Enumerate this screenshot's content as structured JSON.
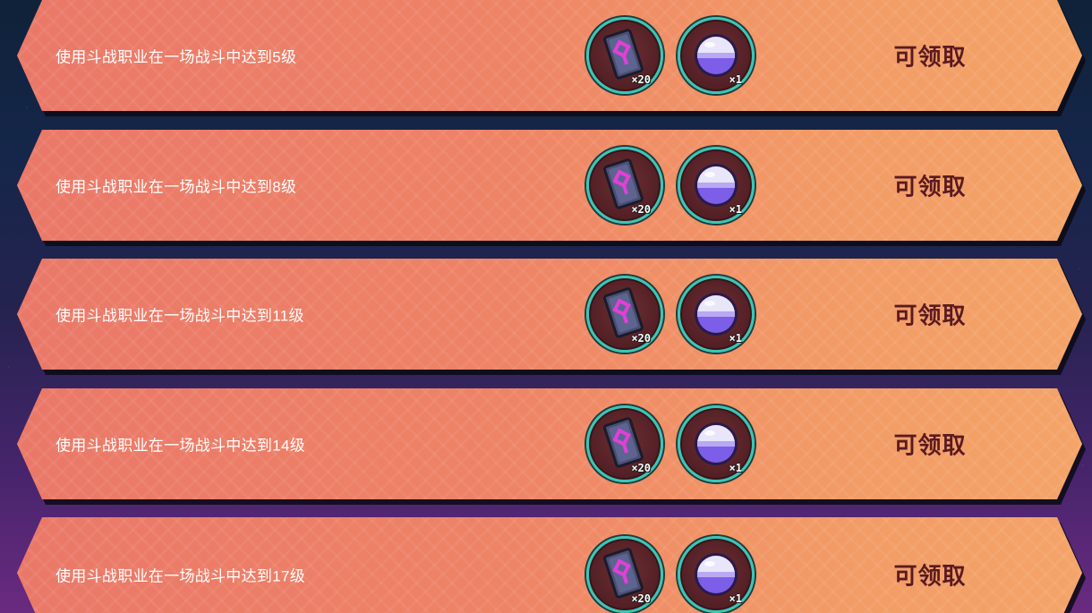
{
  "quests": [
    {
      "title": "使用斗战职业在一场战斗中达到5级",
      "rewards": [
        {
          "icon": "skill-card-icon",
          "qty": "×20"
        },
        {
          "icon": "energy-orb-icon",
          "qty": "×1"
        }
      ],
      "claim_label": "可领取"
    },
    {
      "title": "使用斗战职业在一场战斗中达到8级",
      "rewards": [
        {
          "icon": "skill-card-icon",
          "qty": "×20"
        },
        {
          "icon": "energy-orb-icon",
          "qty": "×1"
        }
      ],
      "claim_label": "可领取"
    },
    {
      "title": "使用斗战职业在一场战斗中达到11级",
      "rewards": [
        {
          "icon": "skill-card-icon",
          "qty": "×20"
        },
        {
          "icon": "energy-orb-icon",
          "qty": "×1"
        }
      ],
      "claim_label": "可领取"
    },
    {
      "title": "使用斗战职业在一场战斗中达到14级",
      "rewards": [
        {
          "icon": "skill-card-icon",
          "qty": "×20"
        },
        {
          "icon": "energy-orb-icon",
          "qty": "×1"
        }
      ],
      "claim_label": "可领取"
    },
    {
      "title": "使用斗战职业在一场战斗中达到17级",
      "rewards": [
        {
          "icon": "skill-card-icon",
          "qty": "×20"
        },
        {
          "icon": "energy-orb-icon",
          "qty": "×1"
        }
      ],
      "claim_label": "可领取"
    }
  ],
  "colors": {
    "banner_left": "#ea7868",
    "banner_right": "#f4a468",
    "slot_ring": "#39c7b7",
    "claim_text": "#5a1a20",
    "title_text": "#ffffff"
  }
}
